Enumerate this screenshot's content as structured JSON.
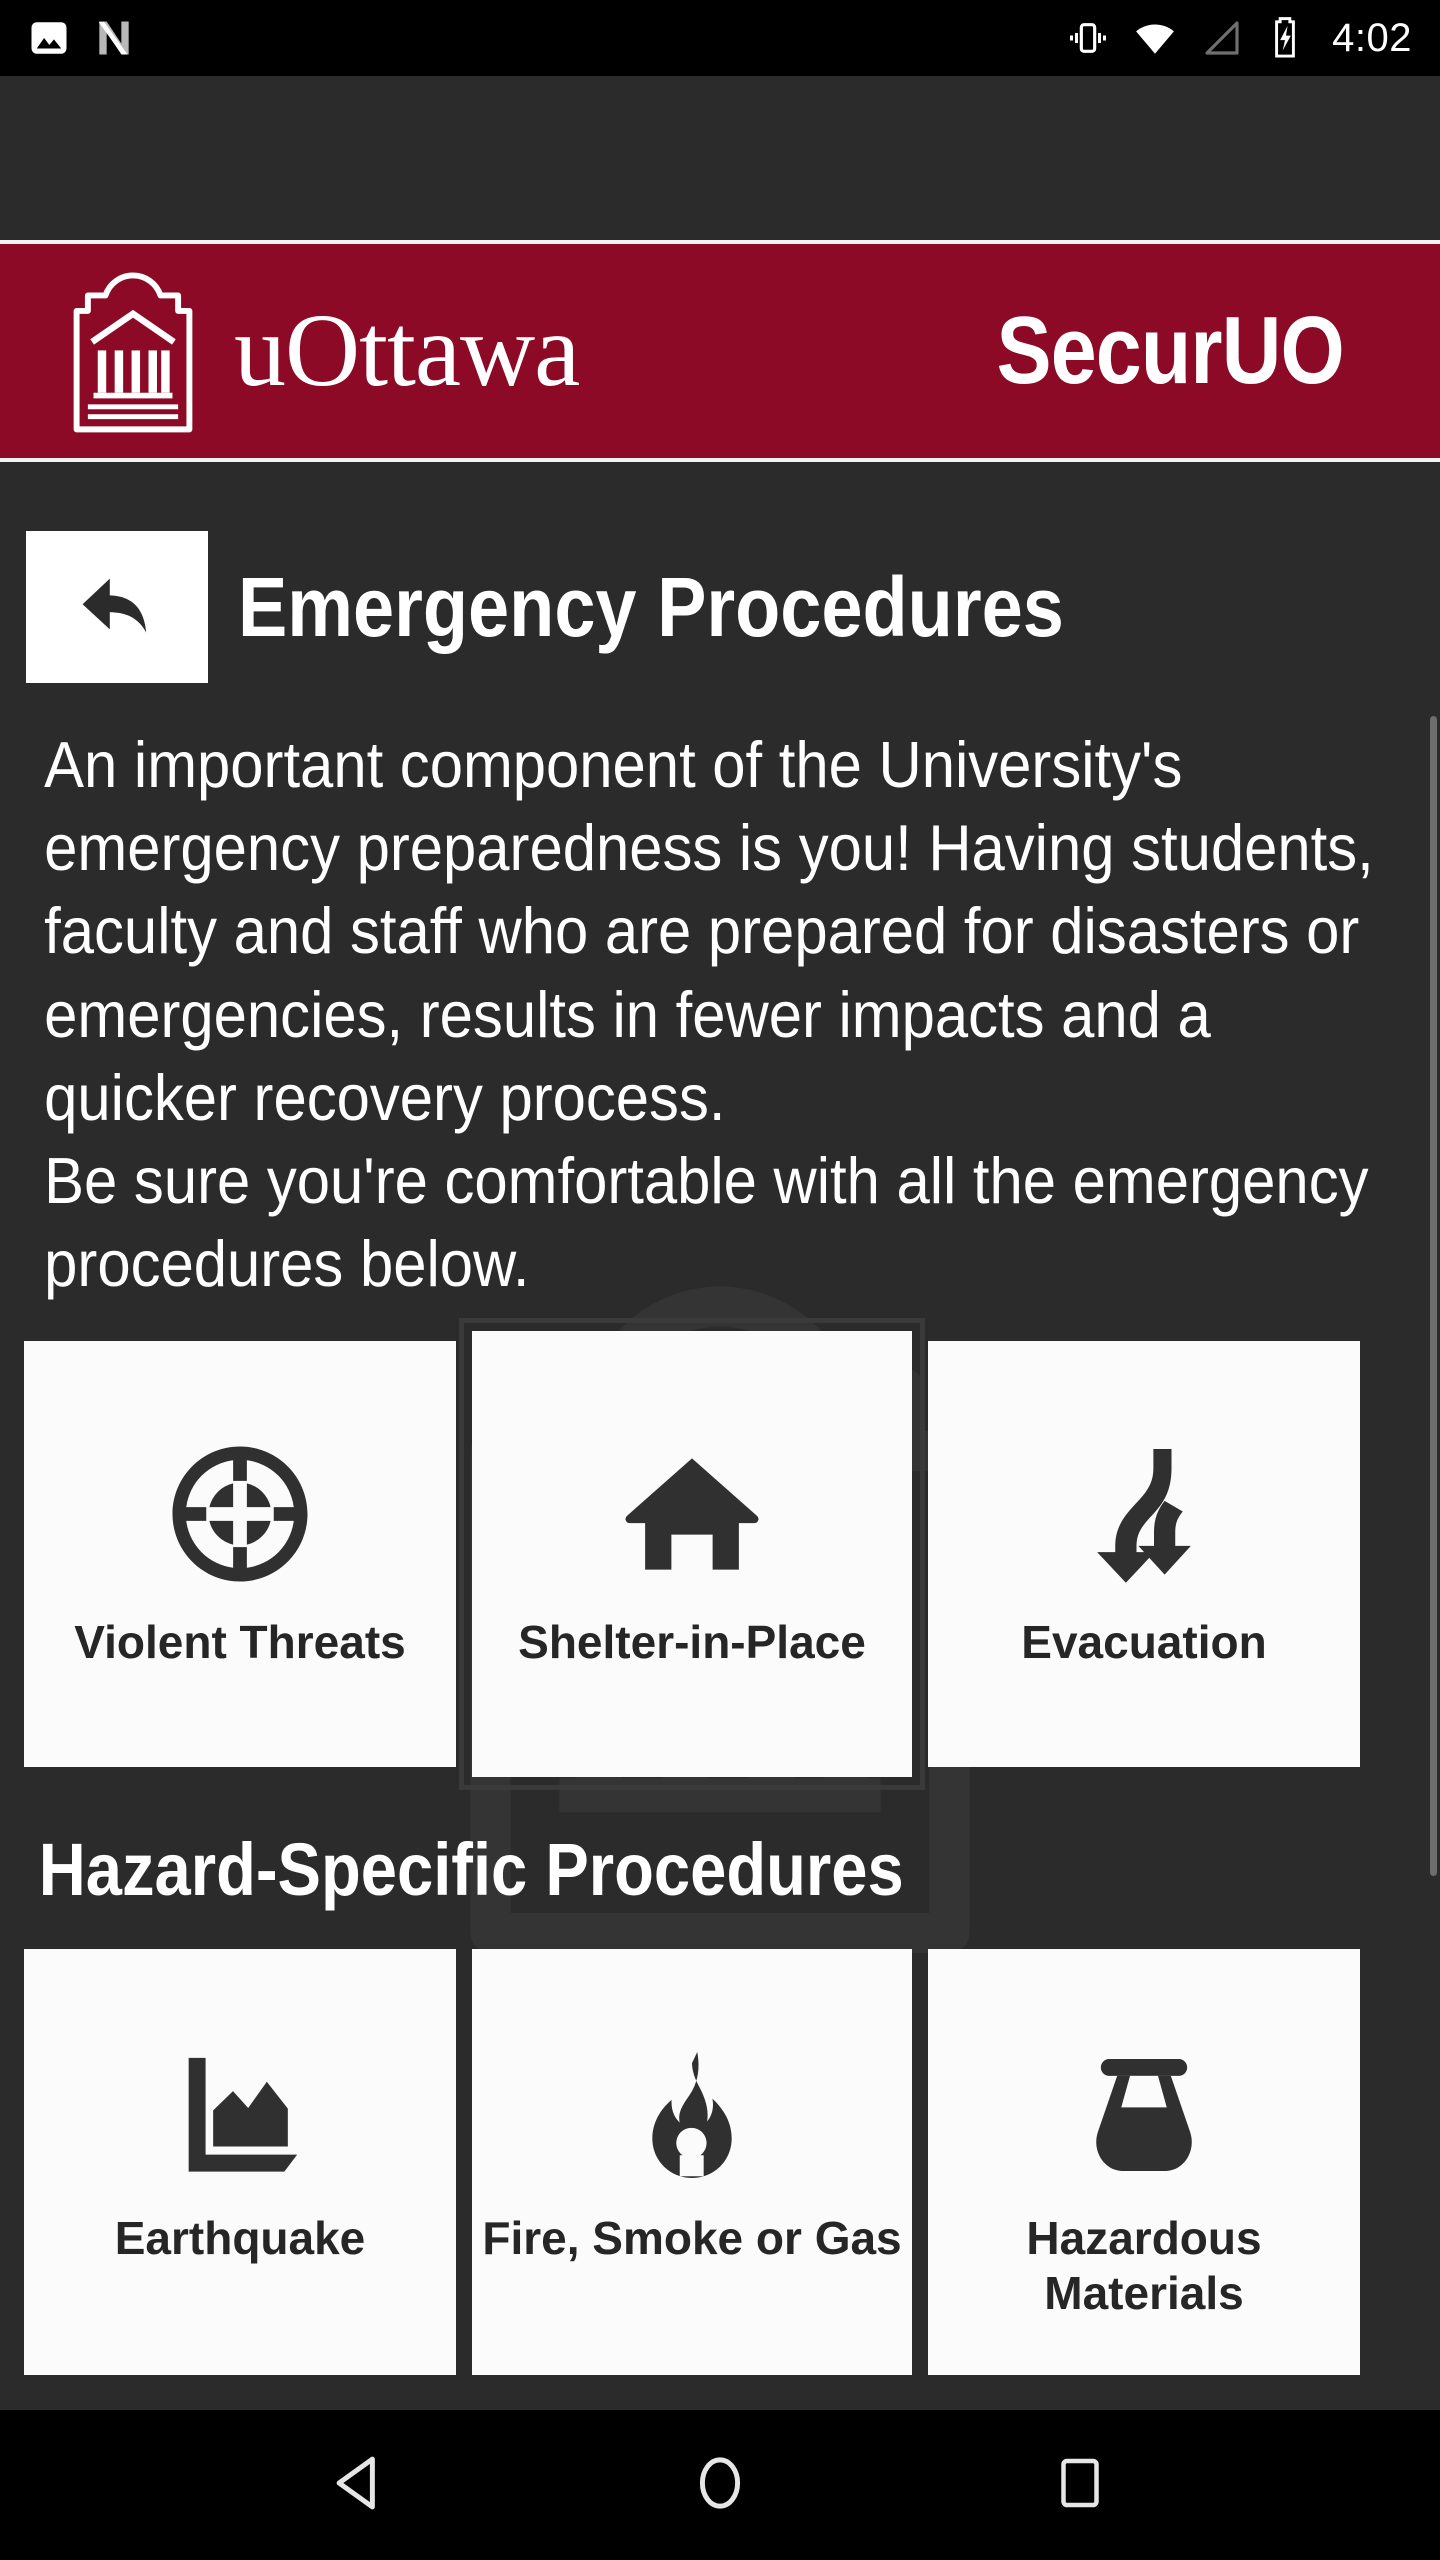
{
  "status_bar": {
    "icons_left": [
      "image-icon",
      "android-nougat-icon"
    ],
    "icons_right": [
      "vibrate-icon",
      "wifi-icon",
      "cellular-signal-icon",
      "battery-charging-icon"
    ],
    "time": "4:02"
  },
  "brand_bar": {
    "crest_icon": "uottawa-crest-icon",
    "university": "uOttawa",
    "app_name": "SecurUO",
    "background_color": "#8c0a26"
  },
  "header": {
    "back_icon": "back-arrow-icon",
    "title": "Emergency Procedures"
  },
  "intro": {
    "paragraph": "An important component of the University's emergency preparedness is you! Having students, faculty and staff who are prepared for disasters or emergencies, results in fewer impacts and a quicker recovery process.\nBe sure you're comfortable with all the emergency procedures below."
  },
  "primary_procedures": [
    {
      "label": "Violent Threats",
      "icon": "crosshair-target-icon",
      "highlighted": false
    },
    {
      "label": "Shelter-in-Place",
      "icon": "house-icon",
      "highlighted": true
    },
    {
      "label": "Evacuation",
      "icon": "evacuation-arrows-icon",
      "highlighted": false
    }
  ],
  "section_heading": "Hazard-Specific Procedures",
  "hazard_procedures": [
    {
      "label": "Earthquake",
      "icon": "earthquake-chart-icon"
    },
    {
      "label": "Fire, Smoke or Gas",
      "icon": "flame-icon"
    },
    {
      "label": "Hazardous Materials",
      "icon": "flask-icon"
    }
  ],
  "nav_bar": {
    "back": "nav-back-icon",
    "home": "nav-home-icon",
    "recents": "nav-recents-icon"
  },
  "colors": {
    "brand_red": "#8c0a26",
    "page_background": "#2b2b2b",
    "card_background": "#fbfbfb",
    "card_foreground": "#303030"
  }
}
